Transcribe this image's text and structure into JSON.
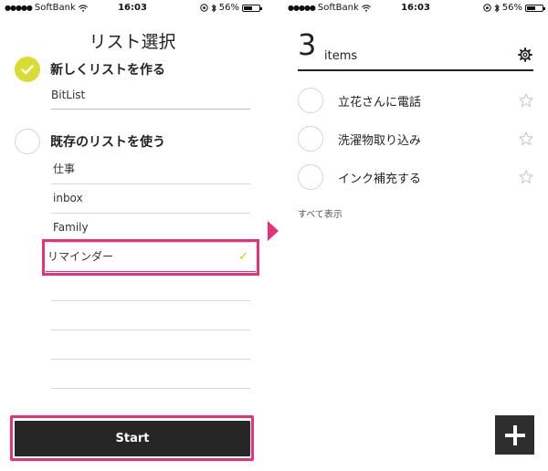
{
  "left_screen": {
    "status": {
      "signal": "●●●●●",
      "carrier": "SoftBank",
      "time": "16:03",
      "battery_pct": "56%"
    },
    "title": "リスト選択",
    "new_list_option": {
      "label": "新しくリストを作る",
      "selected": true,
      "input_value": "BitList"
    },
    "existing_list_option": {
      "label": "既存のリストを使う",
      "selected": false
    },
    "lists": [
      "仕事",
      "inbox",
      "Family",
      "リマインダー"
    ],
    "selected_list": "リマインダー",
    "start_label": "Start"
  },
  "right_screen": {
    "status": {
      "signal": "●●●●●",
      "carrier": "SoftBank",
      "time": "16:03",
      "battery_pct": "56%"
    },
    "item_count": "3",
    "item_count_label": "items",
    "tasks": [
      "立花さんに電話",
      "洗濯物取り込み",
      "インク補充する"
    ],
    "show_all_label": "すべて表示"
  },
  "colors": {
    "accent": "#d9dd33",
    "highlight": "#e8317a",
    "dark_button": "#262626"
  },
  "icons": [
    "wifi-icon",
    "bluetooth-icon",
    "battery-icon",
    "checkmark-icon",
    "gear-icon",
    "star-icon",
    "plus-icon",
    "arrow-right-icon"
  ]
}
